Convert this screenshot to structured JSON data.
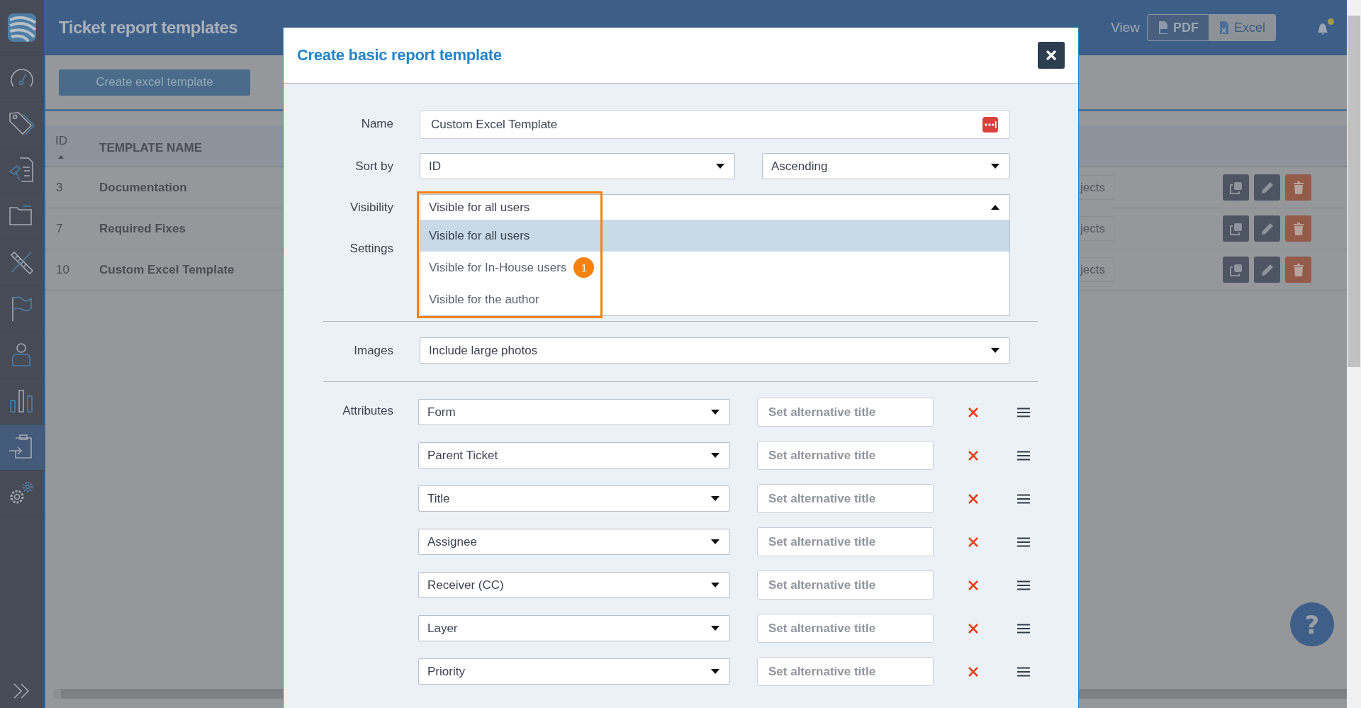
{
  "sidebar": {
    "items": [
      {
        "kind": "logo",
        "selected": false
      },
      {
        "kind": "gauge",
        "selected": false
      },
      {
        "kind": "tag",
        "selected": false
      },
      {
        "kind": "document",
        "selected": false
      },
      {
        "kind": "folder",
        "selected": false
      },
      {
        "kind": "ruler",
        "selected": false
      },
      {
        "kind": "flag",
        "selected": false
      },
      {
        "kind": "person",
        "selected": false
      },
      {
        "kind": "bars",
        "selected": false
      },
      {
        "kind": "clipboard",
        "selected": true
      },
      {
        "kind": "gears",
        "selected": false
      }
    ],
    "expand": {
      "kind": "chevrons"
    }
  },
  "header": {
    "title": "Ticket report templates",
    "view_label": "View",
    "view_options": [
      {
        "label": "PDF",
        "kind": "pdf",
        "selected": false
      },
      {
        "label": "Excel",
        "kind": "excel",
        "selected": true
      }
    ],
    "notifications": {
      "unread": true
    }
  },
  "toolbar": {
    "buttons": [
      {
        "label": "Create excel template"
      }
    ]
  },
  "table": {
    "columns": [
      {
        "label": "ID",
        "sorted": true
      },
      {
        "label": "TEMPLATE NAME",
        "sorted": false
      }
    ],
    "rows": [
      {
        "id": "3",
        "name": "Documentation",
        "column_3": "jects"
      },
      {
        "id": "7",
        "name": "Required Fixes",
        "column_3": "jects"
      },
      {
        "id": "10",
        "name": "Custom Excel Template",
        "column_3": "jects"
      }
    ]
  },
  "help_button": {
    "label": "?"
  },
  "dialog": {
    "title": "Create basic report template",
    "name": {
      "label": "Name",
      "value": "Custom Excel Template"
    },
    "sort_by": {
      "label": "Sort by",
      "field": "ID",
      "order": "Ascending"
    },
    "visibility": {
      "label": "Visibility",
      "value": "Visible for all users",
      "expanded": true,
      "highlighted": true,
      "options": [
        {
          "label": "Visible for all users",
          "selected": true
        },
        {
          "label": "Visible for In-House users",
          "selected": false,
          "marker": "1"
        },
        {
          "label": "Visible for the author",
          "selected": false
        }
      ]
    },
    "settings": {
      "label": "Settings"
    },
    "images": {
      "label": "Images",
      "value": "Include large photos"
    },
    "attributes": {
      "label": "Attributes",
      "rows": [
        {
          "field": "Form",
          "placeholder": "Set alternative title"
        },
        {
          "field": "Parent Ticket",
          "placeholder": "Set alternative title"
        },
        {
          "field": "Title",
          "placeholder": "Set alternative title"
        },
        {
          "field": "Assignee",
          "placeholder": "Set alternative title"
        },
        {
          "field": "Receiver (CC)",
          "placeholder": "Set alternative title"
        },
        {
          "field": "Layer",
          "placeholder": "Set alternative title"
        },
        {
          "field": "Priority",
          "placeholder": "Set alternative title"
        }
      ]
    }
  }
}
